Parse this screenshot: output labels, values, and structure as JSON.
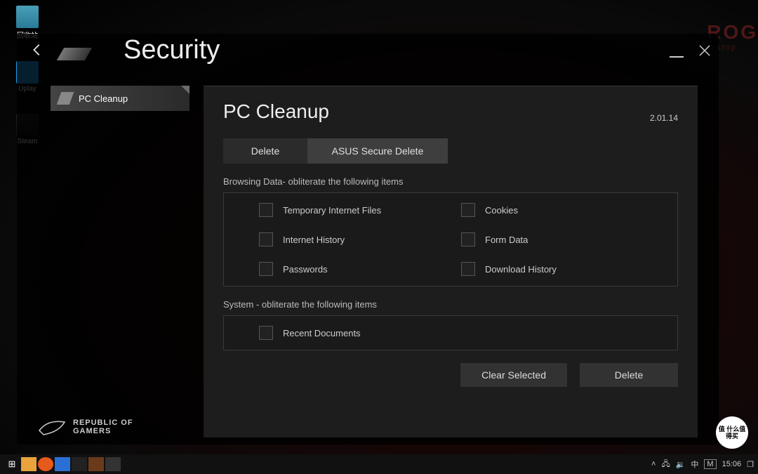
{
  "desktop": {
    "icons": [
      {
        "label": "回收站",
        "class": "recycle"
      },
      {
        "label": "Uplay",
        "class": "uplay"
      },
      {
        "label": "Steam",
        "class": "steam"
      }
    ],
    "corner_brand": "ROG",
    "corner_sub": "Desktop"
  },
  "app": {
    "title": "Security",
    "sidebar": [
      {
        "label": "PC Cleanup"
      }
    ],
    "panel": {
      "title": "PC Cleanup",
      "version": "2.01.14",
      "tabs": [
        {
          "label": "Delete",
          "active": true
        },
        {
          "label": "ASUS Secure Delete",
          "active": false
        }
      ],
      "groups": [
        {
          "label": "Browsing Data- obliterate the following items",
          "items": [
            "Temporary Internet Files",
            "Cookies",
            "Internet History",
            "Form Data",
            "Passwords",
            "Download History"
          ]
        },
        {
          "label": "System - obliterate the following items",
          "items": [
            "Recent Documents"
          ]
        }
      ],
      "actions": [
        "Clear Selected",
        "Delete"
      ]
    },
    "footer": {
      "line1": "REPUBLIC OF",
      "line2": "GAMERS"
    }
  },
  "taskbar": {
    "tray": {
      "ime": "中",
      "mode": "M",
      "time": "15:06",
      "notify": "❐"
    },
    "badge": "值 什么值得买"
  }
}
